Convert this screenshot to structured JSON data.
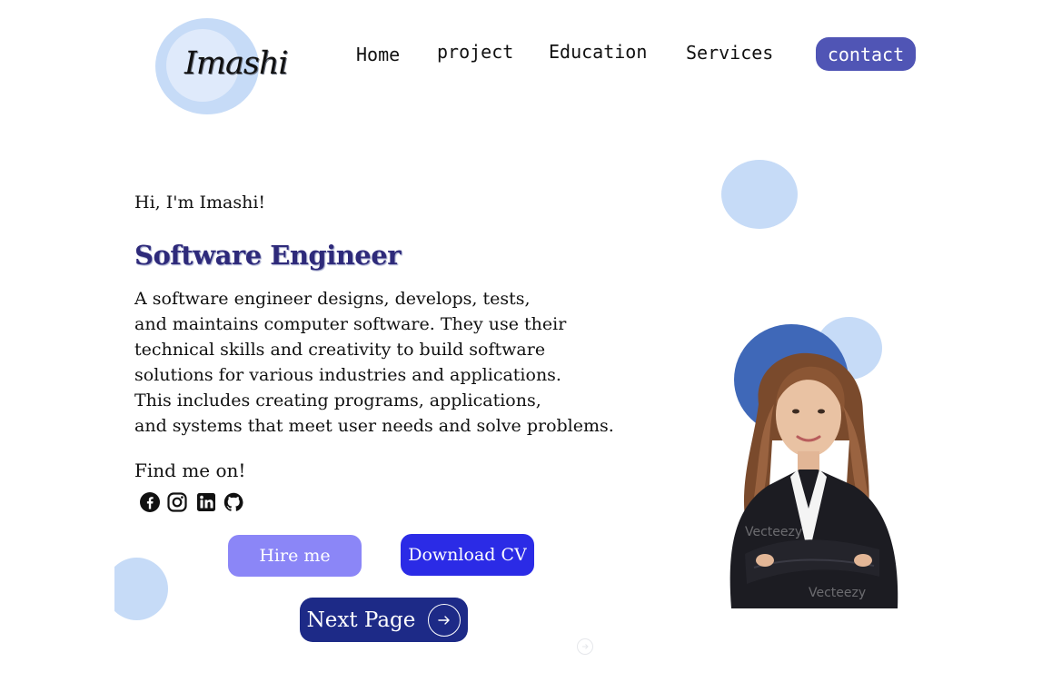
{
  "logo": {
    "text": "Imashi"
  },
  "nav": {
    "items": [
      {
        "label": "Home"
      },
      {
        "label": "project"
      },
      {
        "label": "Education"
      },
      {
        "label": "Services"
      }
    ],
    "contact_label": "contact"
  },
  "hero": {
    "greeting": "Hi, I'm Imashi!",
    "role": "Software Engineer",
    "description_lines": [
      "A software engineer designs, develops, tests,",
      "and maintains computer software. They use their",
      "technical skills and creativity to build software",
      "solutions for various industries and applications.",
      "This includes creating programs, applications,",
      "and systems that meet user needs and solve problems."
    ],
    "find_me_label": "Find me on!"
  },
  "social_icons": [
    "facebook-icon",
    "instagram-icon",
    "linkedin-icon",
    "github-icon"
  ],
  "buttons": {
    "hire": "Hire me",
    "download_cv": "Download CV",
    "next_page": "Next Page"
  },
  "colors": {
    "accent_dark": "#1d2a87",
    "accent_blue": "#2b2be6",
    "accent_light": "#8b86f7",
    "contact_bg": "#5055b5",
    "circle_light": "#c6dbf7",
    "circle_dark": "#3f68b8",
    "role_text": "#2e2a7a"
  },
  "portrait": {
    "watermark": "Vecteezy"
  }
}
